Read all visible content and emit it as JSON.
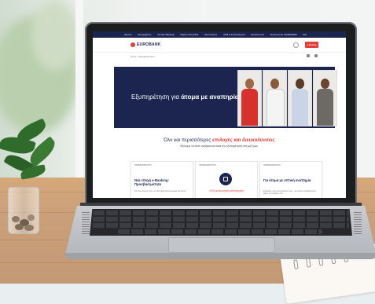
{
  "scene": {
    "description_colors": {
      "desk": "#caa07a",
      "lid": "#1c1d1f",
      "laptop_base": "#b3b7bb"
    }
  },
  "website": {
    "brand": "EUROBANK",
    "brand_color": "#e4403a",
    "navy": "#1b2550",
    "topbar_links": [
      "Ιδιώτες",
      "Επιχειρήσεις",
      "Private Banking",
      "Όμιλος Eurobank",
      "Εντοπισμός",
      "ATM & Καταστήματα",
      "Επικοινωνία",
      "Επικοινωνία 2109554000",
      "EN"
    ],
    "cta_label": "e-Banking",
    "breadcrumb": "Home › Προσβασιμότητα",
    "hero_title_plain": "Εξυπηρέτηση για ",
    "hero_title_bold": "άτομα με αναπηρία",
    "headline_plain": "Όλο και περισσότερες ",
    "headline_emph": "επιλογές και διευκολύνσεις",
    "subhead": "Θέλουμε να είστε ανεξάρτητοι κατά την εξυπηρέτησή σας μαζί μας.",
    "cards": [
      {
        "tag": "ΠΡΟΣΒΑΣΙΜΟΤΗΤΑ",
        "title": "Νέα εποχή e-Banking: Προσβασιμότητα",
        "text": "Για να μπορούν όλοι να εξυπηρετούνται εύκολα και άνετα"
      },
      {
        "tag": "ΠΡΟΣΒΑΣΙΜΟΤΗΤΑ",
        "title": "ATM με φωνητική καθοδήγηση",
        "text": ""
      },
      {
        "tag": "ΠΡΟΣΒΑΣΙΜΟΤΗΤΑ",
        "title": "Για άτομα με οπτική αναπηρία",
        "text": "Επιλογές στην εξυπηρέτησή σας, που έχουν σχεδιαστεί με βάση τις ανάγκες σας"
      }
    ],
    "icons": [
      "eurobank-logo-icon",
      "search-icon",
      "print-icon",
      "share-icon",
      "atm-icon"
    ]
  }
}
